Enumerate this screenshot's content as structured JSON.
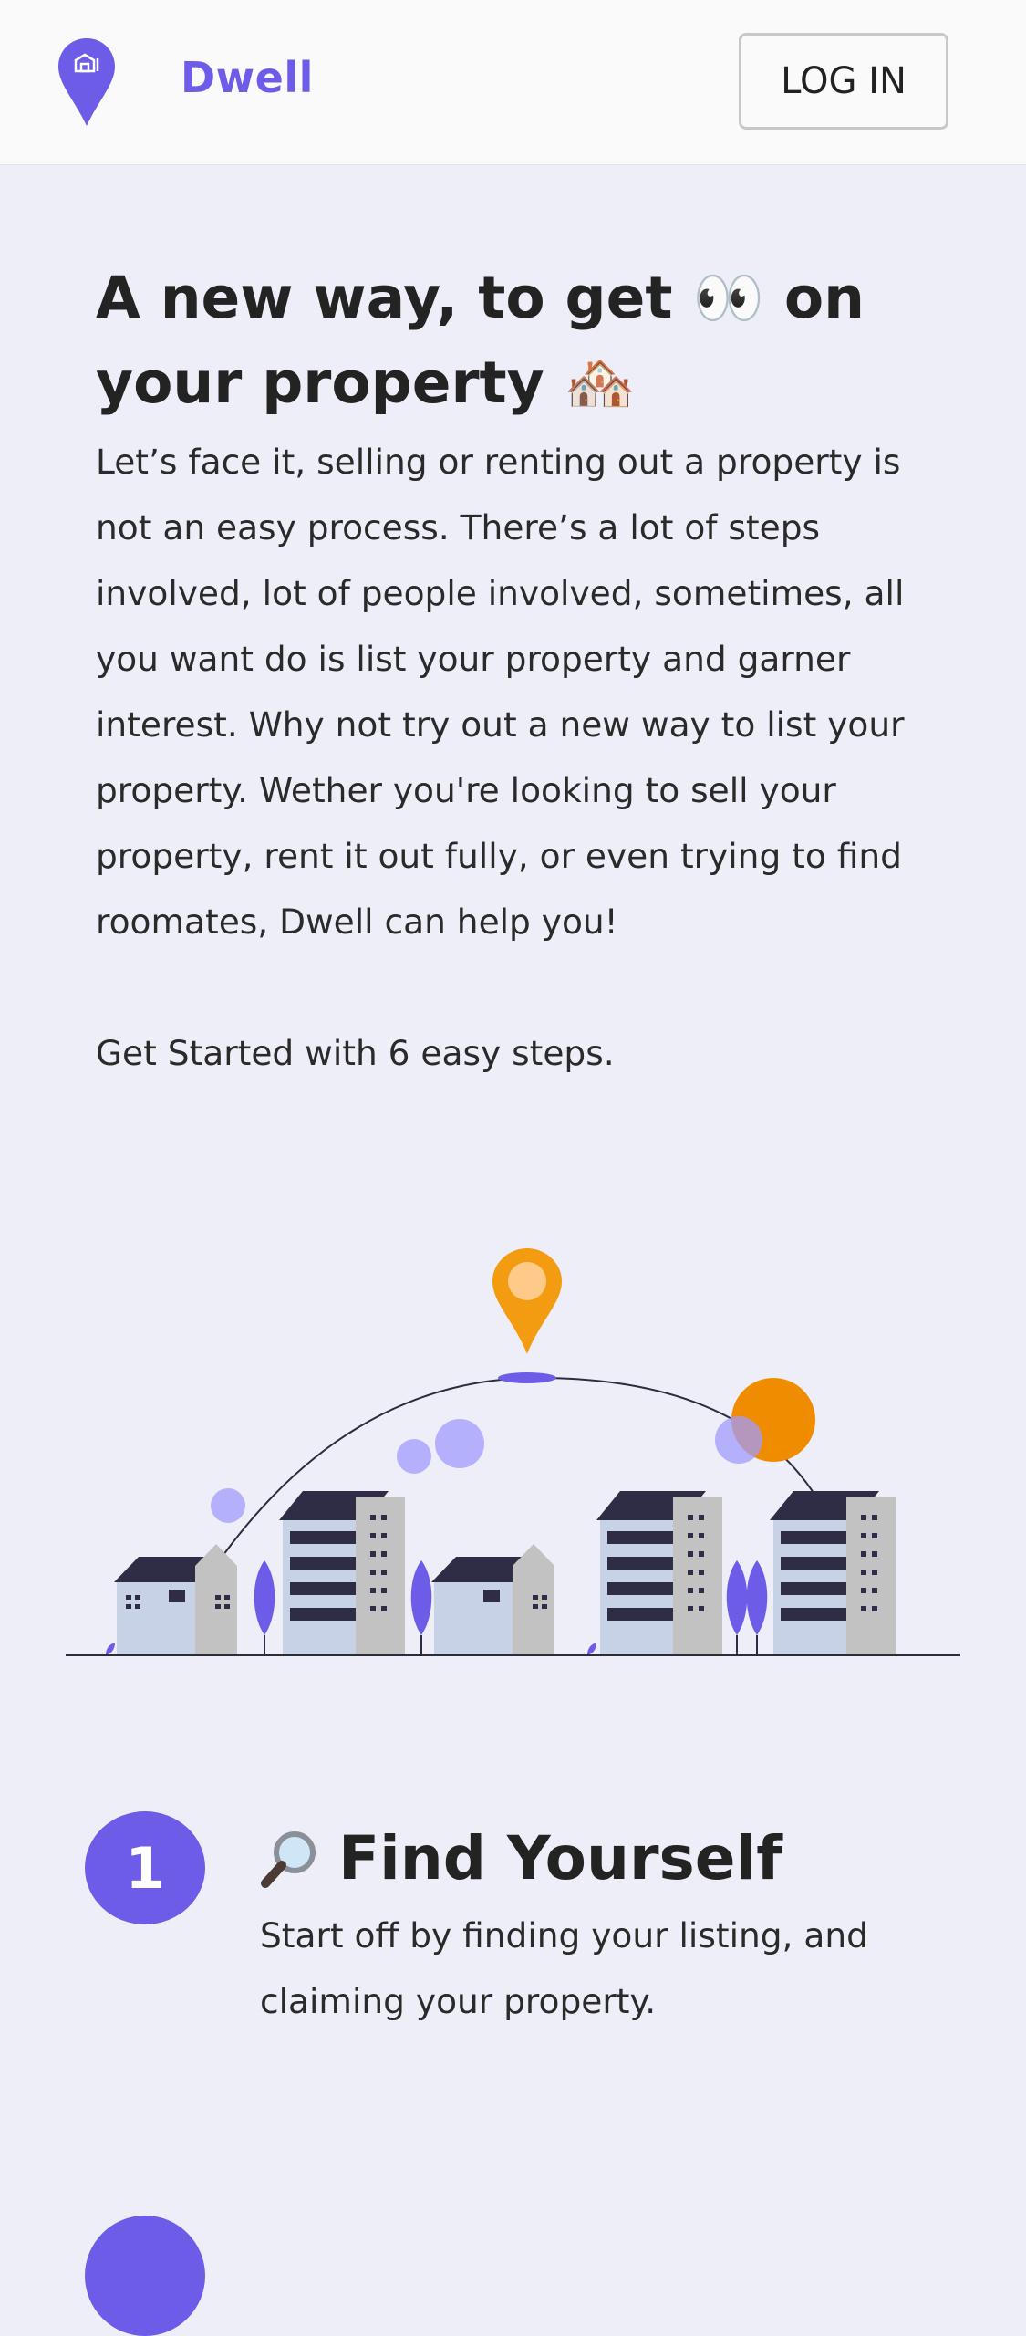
{
  "header": {
    "brand": "Dwell",
    "login_label": "LOG IN"
  },
  "hero": {
    "title_part1": "A new way, to get",
    "title_part2": "on your property",
    "eyes_emoji": "👀",
    "house_emoji": "🏘️",
    "paragraph": "Let’s face it, selling or renting out a property is not an easy process. There’s a lot of steps involved, lot of people involved, sometimes, all you want do is list your property and garner interest. Why not try out a new way to list your property. Wether you're looking to sell your property, rent it out fully, or even trying to find roomates, Dwell can help you!",
    "steps_intro": "Get Started with 6 easy steps."
  },
  "steps": [
    {
      "number": "1",
      "icon": "magnifier-icon",
      "title": "Find Yourself",
      "description": "Start off by finding your listing, and claiming your property."
    }
  ],
  "colors": {
    "brand": "#6c5ce7",
    "background": "#eeeef8",
    "header_bg": "#fafafa",
    "accent_orange": "#f39c12"
  }
}
